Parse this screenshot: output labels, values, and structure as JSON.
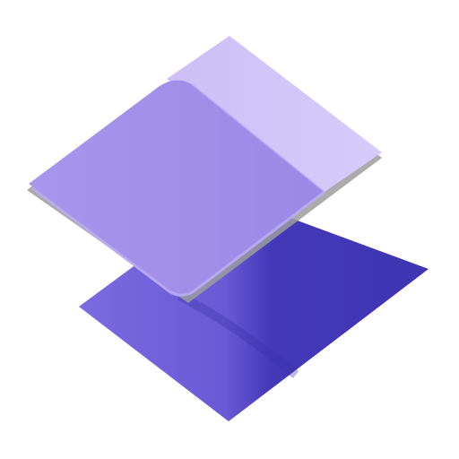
{
  "icon": {
    "name": "stacked-layers-icon",
    "colors": {
      "background": "#ffffff",
      "bottom_layer_light": "#7b6be0",
      "bottom_layer_dark": "#3f35b3",
      "top_layer_light": "#a796ec",
      "top_layer_back": "#cdbff7",
      "shadow": "#9c9c9c"
    }
  }
}
